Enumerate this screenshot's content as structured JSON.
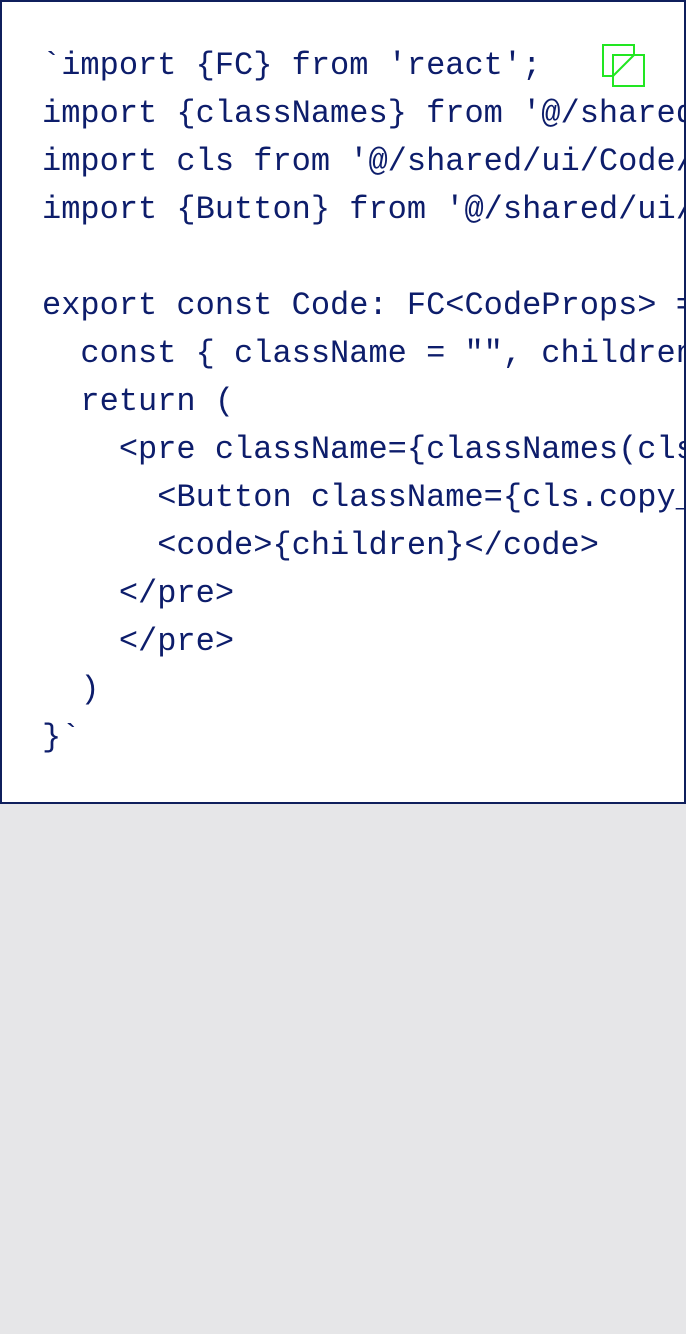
{
  "code": {
    "lines": [
      "`import {FC} from 'react';",
      "import {classNames} from '@/shared/lib/classNames/classNames';",
      "import cls from '@/shared/ui/Code/Code.module.scss';",
      "import {Button} from '@/shared/ui/Button/Button';",
      "",
      "export const Code: FC<CodeProps> = (props) => {",
      "  const { className = \"\", children } = props;",
      "  return (",
      "    <pre className={classNames(cls.Code, {}, [className])}>",
      "      <Button className={cls.copy_btn}>",
      "      <code>{children}</code>",
      "    </pre>",
      "    </pre>",
      "  )",
      "}`"
    ]
  },
  "copy_button": {
    "icon": "copy-icon",
    "color": "#22e622"
  },
  "colors": {
    "code_text": "#0d1d6b",
    "panel_border": "#0f1f5c",
    "panel_background": "#ffffff",
    "page_background": "#e6e6e8"
  }
}
